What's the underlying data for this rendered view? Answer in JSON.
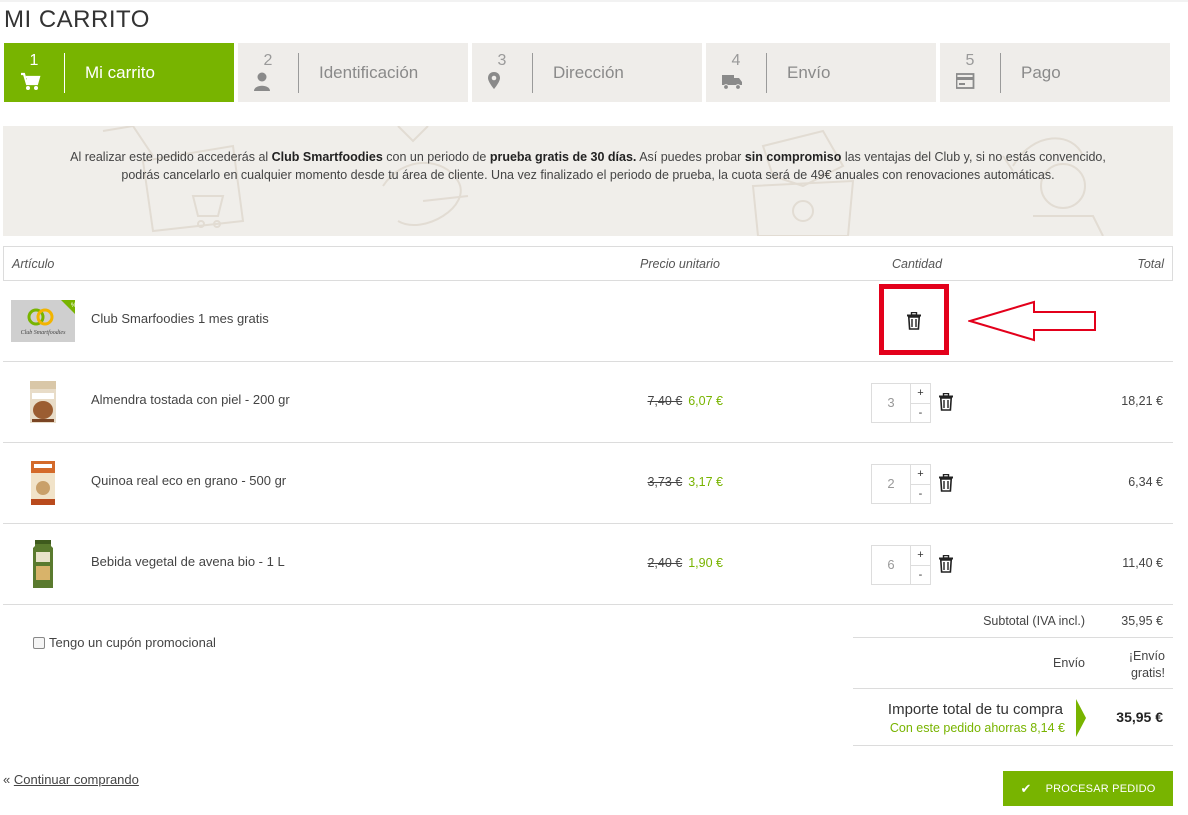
{
  "page_title": "MI CARRITO",
  "steps": [
    {
      "num": "1",
      "label": "Mi carrito",
      "icon": "cart-icon",
      "active": true
    },
    {
      "num": "2",
      "label": "Identificación",
      "icon": "user-icon",
      "active": false
    },
    {
      "num": "3",
      "label": "Dirección",
      "icon": "location-pin-icon",
      "active": false
    },
    {
      "num": "4",
      "label": "Envío",
      "icon": "truck-icon",
      "active": false
    },
    {
      "num": "5",
      "label": "Pago",
      "icon": "credit-card-icon",
      "active": false
    }
  ],
  "banner": {
    "t1": "Al realizar este pedido accederás al ",
    "b1": "Club Smartfoodies",
    "t2": " con un periodo de ",
    "b2": "prueba gratis de 30 días.",
    "t3": " Así puedes probar ",
    "b3": "sin compromiso",
    "t4": " las ventajas del Club y, si no estás convencido, podrás cancelarlo en cualquier momento desde tu área de cliente. Una vez finalizado el periodo de prueba, la cuota será de 49€ anuales con renovaciones automáticas."
  },
  "table": {
    "headers": {
      "article": "Artículo",
      "unit_price": "Precio unitario",
      "quantity": "Cantidad",
      "total": "Total"
    },
    "rows": [
      {
        "name": "Club Smarfoodies 1 mes gratis",
        "old_price": "",
        "new_price": "",
        "qty": "",
        "total": ""
      },
      {
        "name": "Almendra tostada con piel - 200 gr",
        "old_price": "7,40 €",
        "new_price": "6,07 €",
        "qty": "3",
        "total": "18,21 €"
      },
      {
        "name": "Quinoa real eco en grano - 500 gr",
        "old_price": "3,73 €",
        "new_price": "3,17 €",
        "qty": "2",
        "total": "6,34 €"
      },
      {
        "name": "Bebida vegetal de avena bio - 1 L",
        "old_price": "2,40 €",
        "new_price": "1,90 €",
        "qty": "6",
        "total": "11,40 €"
      }
    ],
    "plus": "+",
    "minus": "-",
    "club_badge": "%",
    "club_logo_text": "Club Smartfoodies"
  },
  "coupon_label": "Tengo un cupón promocional",
  "summary": {
    "subtotal_label": "Subtotal (IVA incl.)",
    "subtotal_value": "35,95 €",
    "shipping_label": "Envío",
    "shipping_value_1": "¡Envío",
    "shipping_value_2": "gratis!",
    "total_label": "Importe total de tu compra",
    "savings": "Con este pedido ahorras 8,14 €",
    "total_value": "35,95 €"
  },
  "continue": {
    "prefix": "« ",
    "link": "Continuar comprando"
  },
  "process_button": {
    "check": "✔",
    "label": "PROCESAR PEDIDO"
  },
  "colors": {
    "accent": "#78b400",
    "highlight": "#e3001b",
    "step_bg": "#efedea"
  }
}
